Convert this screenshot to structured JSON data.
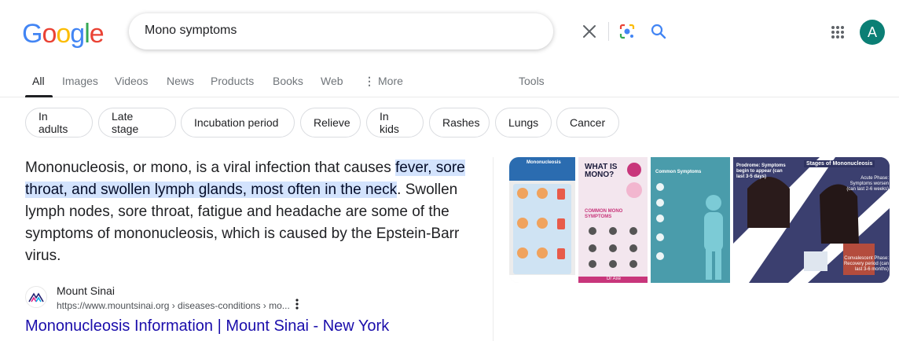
{
  "header": {
    "logo_letters": [
      "G",
      "o",
      "o",
      "g",
      "l",
      "e"
    ],
    "logo_colors": [
      "#4285f4",
      "#ea4335",
      "#fbbc05",
      "#4285f4",
      "#34a853",
      "#ea4335"
    ],
    "search_query": "Mono symptoms",
    "avatar_letter": "A"
  },
  "tabs": [
    "All",
    "Images",
    "Videos",
    "News",
    "Products",
    "Books",
    "Web",
    "More",
    "Tools"
  ],
  "chips": [
    "In adults",
    "Late stage",
    "Incubation period",
    "Relieve",
    "In kids",
    "Rashes",
    "Lungs",
    "Cancer"
  ],
  "snippet": {
    "before": "Mononucleosis, or mono, is a viral infection that causes ",
    "highlight": "fever, sore throat, and swollen lymph glands, most often in the neck",
    "after": ". Swollen lymph nodes, sore throat, fatigue and headache are some of the symptoms of mononucleosis, which is caused by the Epstein-Barr virus."
  },
  "source": {
    "name": "Mount Sinai",
    "url": "https://www.mountsinai.org › diseases-conditions › mo...",
    "link_title": "Mononucleosis Information | Mount Sinai - New York"
  },
  "images": {
    "img1_title": "Mononucleosis",
    "img2_title": "WHAT IS MONO?",
    "img2_sub": "COMMON MONO SYMPTOMS",
    "img2_footer": "Dr Axe",
    "img3_title": "Common Symptoms",
    "img4_title": "Stages of Mononucleosis",
    "img4_prodrome": "Prodrome: Symptoms begin to appear (can last 3-5 days)",
    "img4_acute": "Acute Phase: Symptoms worsen (can last 2-6 weeks)",
    "img4_convalescent": "Convalescent Phase: Recovery period (can last 3-6 months)"
  },
  "colors": {
    "link": "#1a0dab",
    "highlight": "#d3e3fd",
    "avatar": "#0b7f75"
  }
}
